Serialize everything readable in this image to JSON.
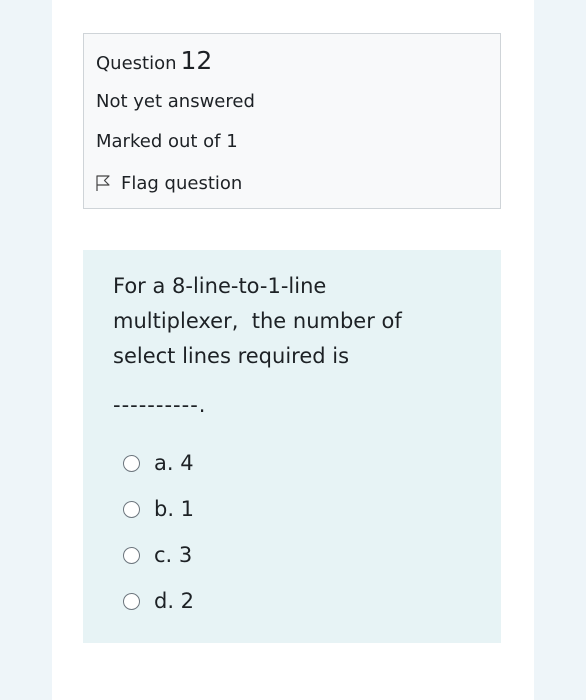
{
  "info": {
    "question_label": "Question",
    "question_number": "12",
    "state": "Not yet answered",
    "grade": "Marked out of 1",
    "flag_label": "Flag question"
  },
  "question": {
    "text_line1": "For a 8-line-to-1-line",
    "text_line2": "multiplexer,  the number of",
    "text_line3": "select lines required is",
    "blank": "----------.",
    "answers": [
      {
        "label": "a. 4"
      },
      {
        "label": "b. 1"
      },
      {
        "label": "c. 3"
      },
      {
        "label": "d. 2"
      }
    ]
  },
  "icons": {
    "flag": "flag-outline-icon",
    "radio": "radio-unchecked-icon"
  }
}
